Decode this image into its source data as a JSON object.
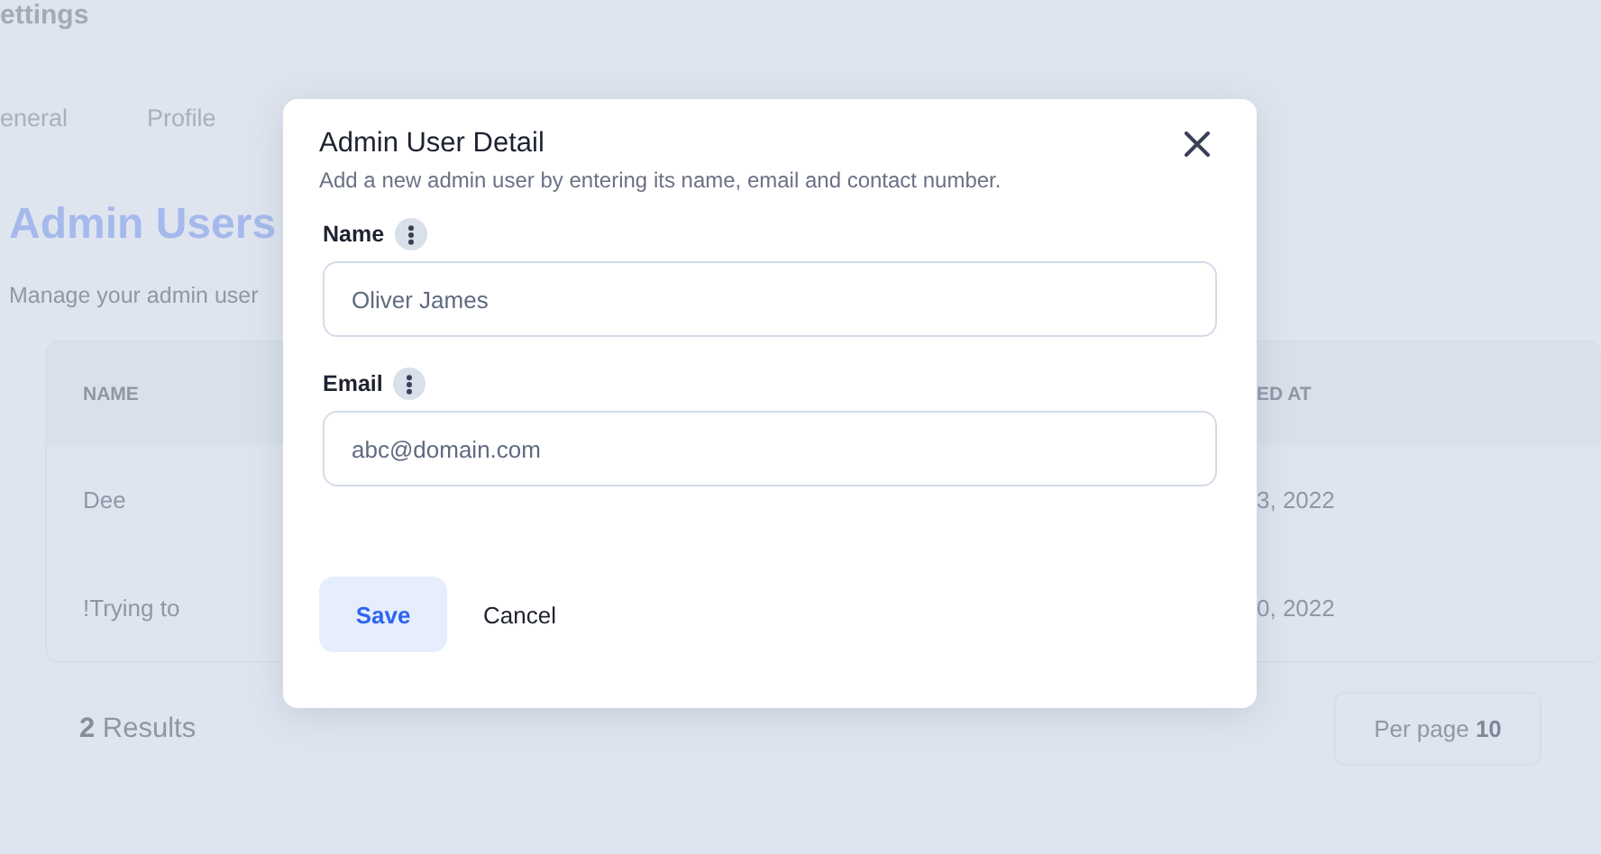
{
  "page": {
    "title": "ettings",
    "tabs": [
      {
        "label": "eneral",
        "selected": false
      },
      {
        "label": "Profile",
        "selected": false
      }
    ],
    "heading": "Admin Users",
    "subtitle": "Manage your admin user"
  },
  "table": {
    "columns": [
      "NAME",
      "ED AT"
    ],
    "rows": [
      [
        "Dee",
        "3, 2022"
      ],
      [
        "!Trying to",
        "0, 2022"
      ]
    ]
  },
  "footer": {
    "count": "2",
    "results_label": "Results",
    "per_page_label": "Per page",
    "per_page_value": "10"
  },
  "dialog": {
    "title": "Admin User Detail",
    "description": "Add a new admin user by entering its name, email and contact number.",
    "fields": [
      {
        "label": "Name",
        "value": "Oliver James"
      },
      {
        "label": "Email",
        "value": "abc@domain.com"
      }
    ],
    "buttons": [
      {
        "label": "Save",
        "kind": "primary"
      },
      {
        "label": "Cancel",
        "kind": "plain"
      }
    ]
  }
}
